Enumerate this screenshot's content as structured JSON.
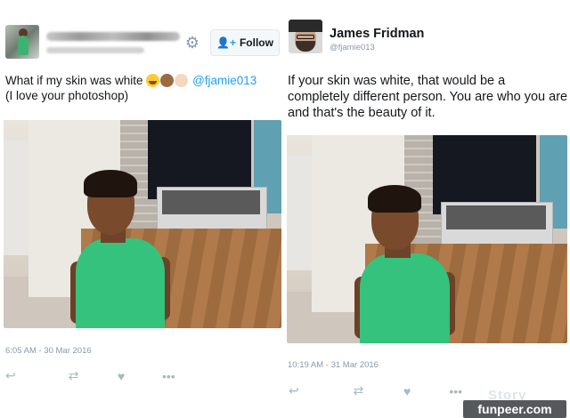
{
  "left_tweet": {
    "follow_label": "Follow",
    "text_before": "What if my skin was white ",
    "mention": "@fjamie013",
    "text_line2": "(I love your photoshop)",
    "timestamp": "6:05 AM - 30 Mar 2016",
    "icons": [
      "settings-gear-icon",
      "person-plus-icon",
      "laughing-emoji",
      "brown-face-emoji",
      "white-face-emoji",
      "reply-icon",
      "retweet-icon",
      "like-heart-icon",
      "more-dots-icon"
    ]
  },
  "right_tweet": {
    "name": "James Fridman",
    "handle": "@fjamie013",
    "text": "If your skin was white, that would be a completely different person. You are who you are and that's the beauty of it.",
    "timestamp": "10:19 AM - 31 Mar 2016"
  },
  "glyphs": {
    "gear": "⚙",
    "person_plus": "👤+",
    "reply": "↩",
    "retweet": "⇄",
    "like": "♥",
    "more": "•••"
  },
  "watermark": {
    "brand": "funpeer.com",
    "faint": "Story"
  },
  "colors": {
    "link_blue": "#1da1f2",
    "meta_gray": "#8899a6",
    "action_gray": "#aab8c2",
    "shirt_green": "#34c27d"
  }
}
